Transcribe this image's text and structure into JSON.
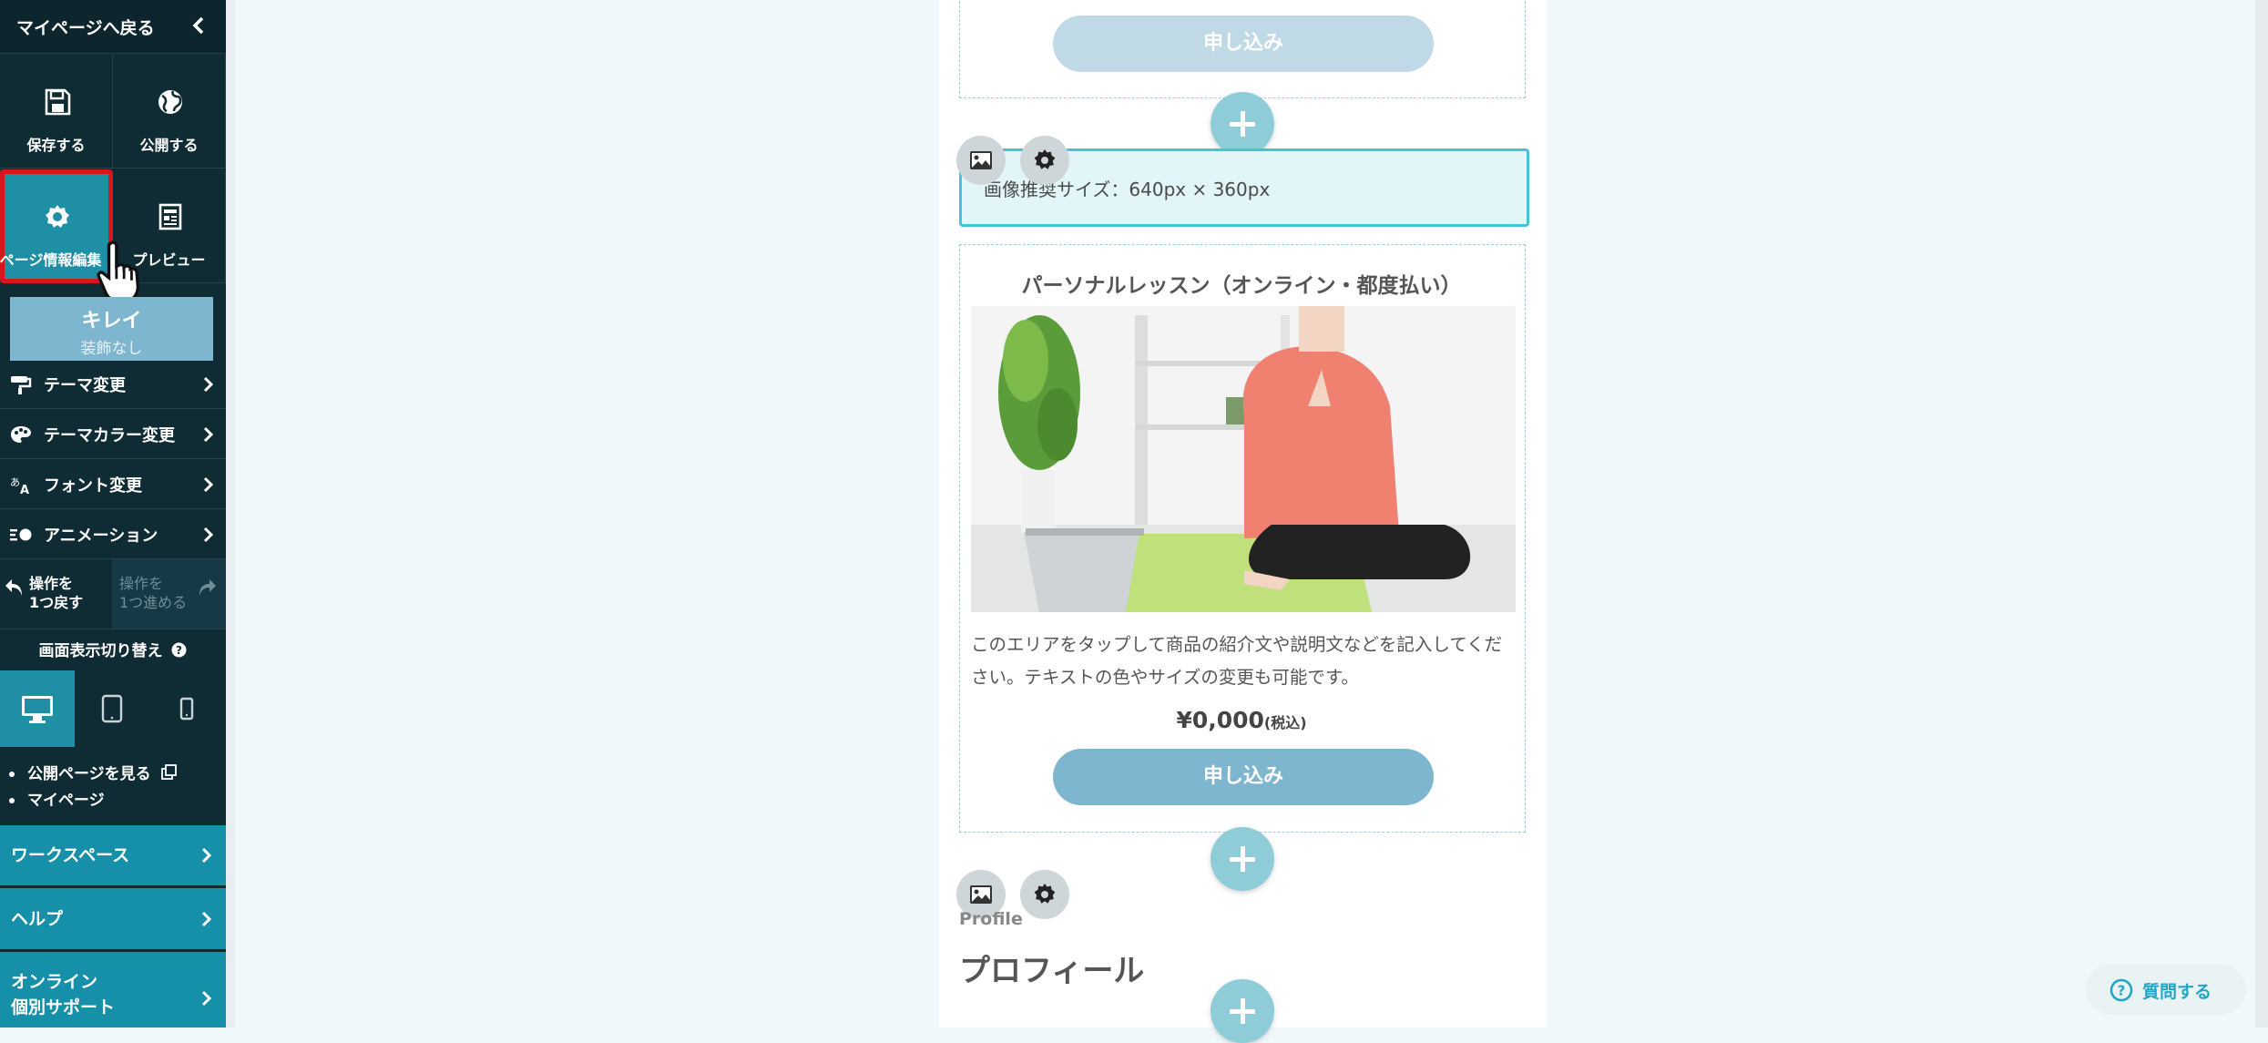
{
  "sidebar": {
    "back_label": "マイページへ戻る",
    "save_label": "保存する",
    "publish_label": "公開する",
    "page_info_label": "ページ情報編集",
    "preview_label": "プレビュー",
    "theme_name": "キレイ",
    "theme_sub": "装飾なし",
    "menu": [
      {
        "label": "テーマ変更"
      },
      {
        "label": "テーマカラー変更"
      },
      {
        "label": "フォント変更"
      },
      {
        "label": "アニメーション"
      }
    ],
    "undo_line1": "操作を",
    "undo_line2": "1つ戻す",
    "redo_line1": "操作を",
    "redo_line2": "1つ進める",
    "display_switch_label": "画面表示切り替え",
    "link_public_page": "公開ページを見る",
    "link_mypage": "マイページ",
    "workspace_label": "ワークスペース",
    "help_label": "ヘルプ",
    "support_line1": "オンライン",
    "support_line2": "個別サポート"
  },
  "editor": {
    "apply_button_top": "申し込み",
    "image_size_hint": "画像推奨サイズ：640px × 360px",
    "product_title": "パーソナルレッスン（オンライン・都度払い）",
    "product_desc": "このエリアをタップして商品の紹介文や説明文などを記入してください。テキストの色やサイズの変更も可能です。",
    "price": "¥0,000",
    "price_tax": "(税込)",
    "apply_button": "申し込み",
    "profile_en": "Profile",
    "profile_jp": "プロフィール",
    "question_label": "質問する"
  },
  "colors": {
    "sidebar_bg": "#0f2c35",
    "accent_teal": "#1690a8",
    "apply_button": "#7eb6d0",
    "apply_button_faded": "#bfd9e6",
    "plus_button": "#8ecdd8",
    "highlight_red": "#d9141b"
  }
}
